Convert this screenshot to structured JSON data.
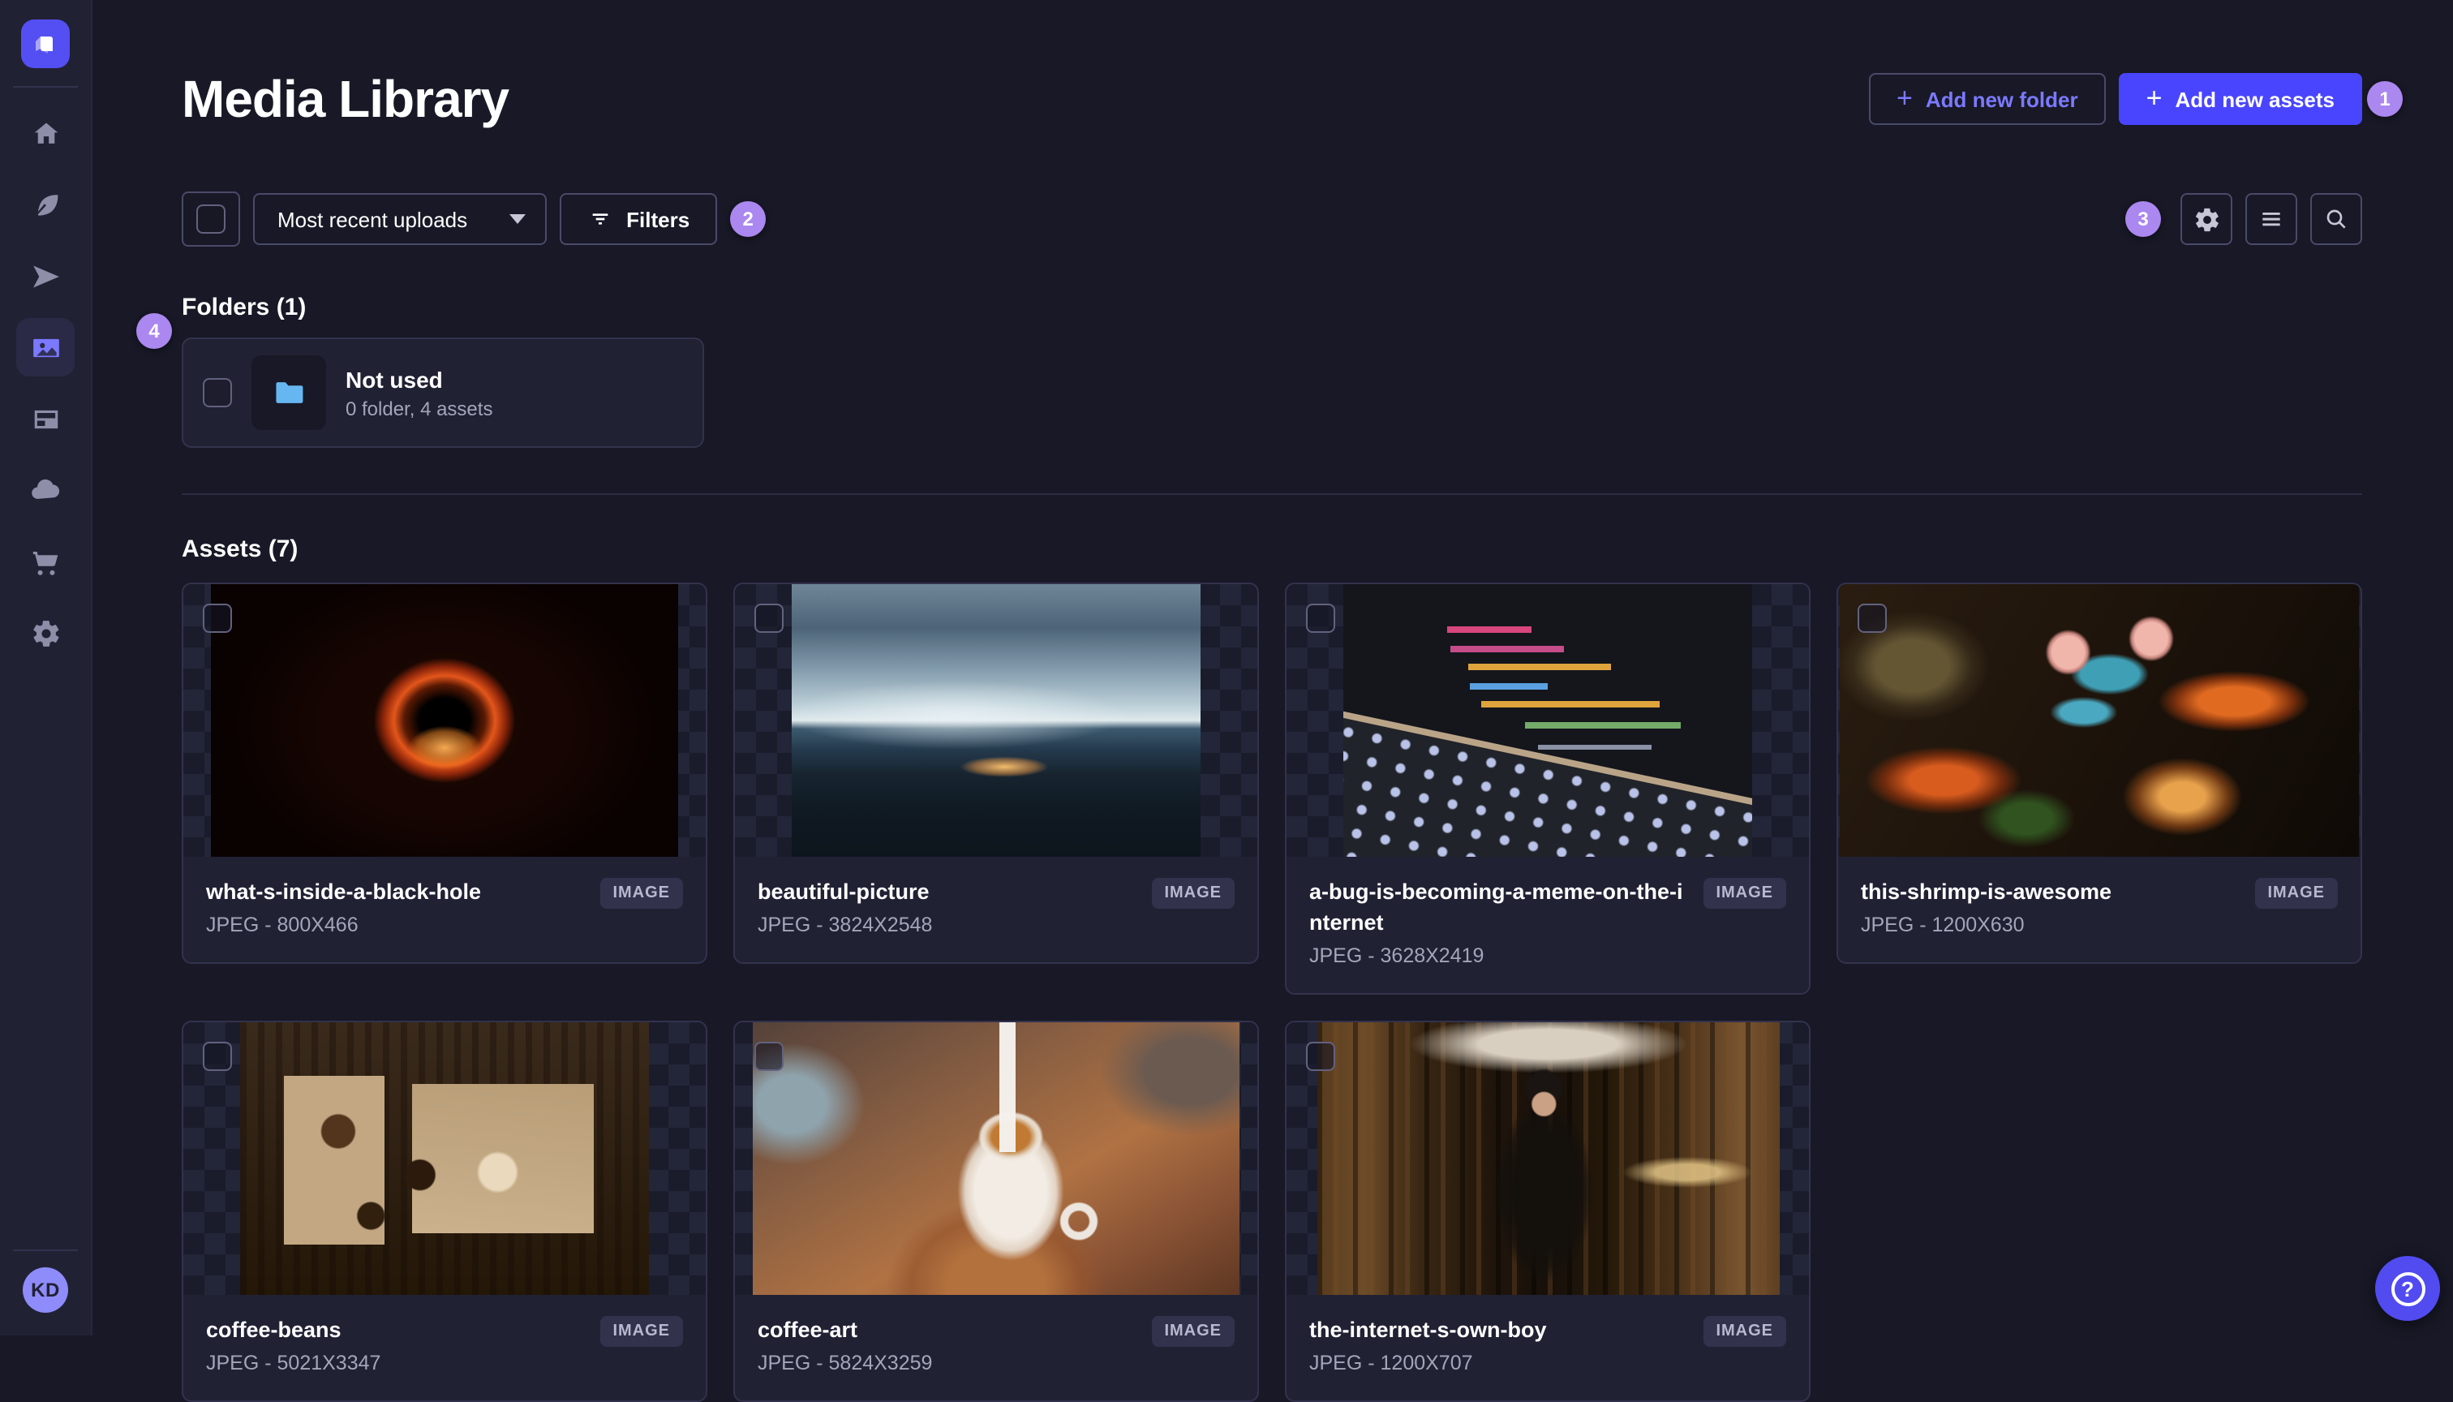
{
  "header": {
    "title": "Media Library",
    "add_folder_label": "Add new folder",
    "add_assets_label": "Add new assets",
    "add_assets_badge": "1"
  },
  "toolbar": {
    "sort_value": "Most recent uploads",
    "filters_label": "Filters",
    "filters_badge": "2",
    "view_settings_badge": "3"
  },
  "folders_section": {
    "heading": "Folders (1)",
    "badge": "4",
    "folder": {
      "title": "Not used",
      "subtitle": "0 folder, 4 assets"
    }
  },
  "assets_section": {
    "heading": "Assets (7)",
    "type_badge": "IMAGE",
    "items": [
      {
        "name": "what-s-inside-a-black-hole",
        "meta": "JPEG - 800X466"
      },
      {
        "name": "beautiful-picture",
        "meta": "JPEG - 3824X2548"
      },
      {
        "name": "a-bug-is-becoming-a-meme-on-the-internet",
        "meta": "JPEG - 3628X2419"
      },
      {
        "name": "this-shrimp-is-awesome",
        "meta": "JPEG - 1200X630"
      },
      {
        "name": "coffee-beans",
        "meta": "JPEG - 5021X3347"
      },
      {
        "name": "coffee-art",
        "meta": "JPEG - 5824X3259"
      },
      {
        "name": "the-internet-s-own-boy",
        "meta": "JPEG - 1200X707"
      }
    ]
  },
  "sidebar": {
    "items": [
      {
        "icon": "home-icon"
      },
      {
        "icon": "content-manager-icon"
      },
      {
        "icon": "releases-icon"
      },
      {
        "icon": "media-library-icon",
        "active": true
      },
      {
        "icon": "content-type-builder-icon"
      },
      {
        "icon": "deploy-icon"
      },
      {
        "icon": "marketplace-icon"
      },
      {
        "icon": "settings-icon"
      }
    ],
    "avatar_initials": "KD"
  },
  "fab": {
    "help_glyph": "?"
  },
  "colors": {
    "background": "#181826",
    "surface": "#212134",
    "border": "#32324d",
    "primary": "#4945ff",
    "primary_light": "#7b79ff",
    "tour_badge": "#ab87f0",
    "folder_blue": "#66b7f1",
    "text_secondary": "#a5a5ba"
  }
}
